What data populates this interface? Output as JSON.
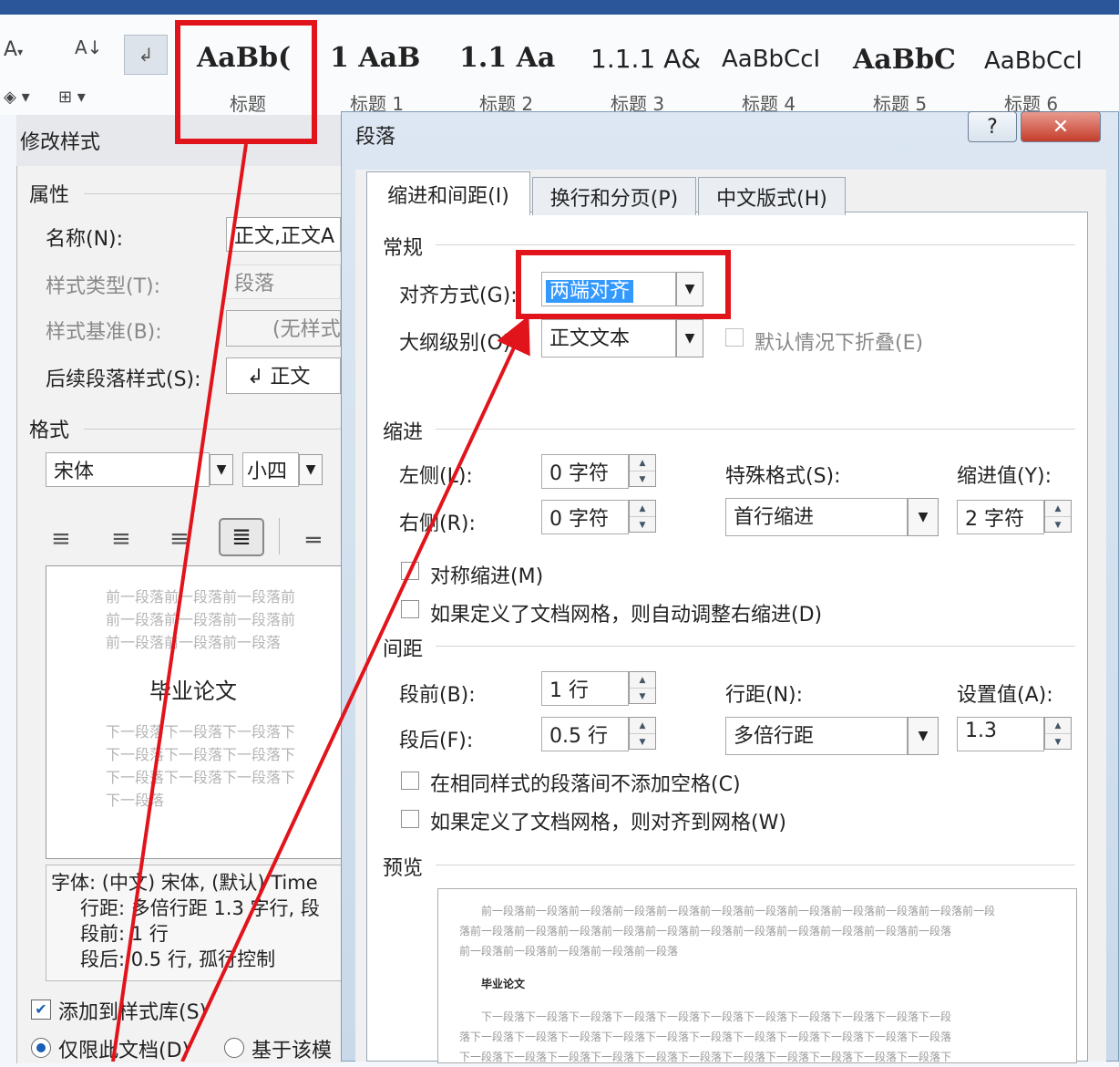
{
  "ribbon": {
    "styles": [
      {
        "sample": "AaBb(",
        "label": "标题"
      },
      {
        "sample": "1  AaB",
        "label": "标题 1"
      },
      {
        "sample": "1.1  Aa",
        "label": "标题 2"
      },
      {
        "sample": "1.1.1  A&",
        "label": "标题 3"
      },
      {
        "sample": "AaBbCcI",
        "label": "标题 4"
      },
      {
        "sample": "AaBbC",
        "label": "标题 5"
      },
      {
        "sample": "AaBbCcl",
        "label": "标题 6"
      }
    ]
  },
  "modify": {
    "title": "修改样式",
    "properties_header": "属性",
    "name_label": "名称(N):",
    "name_value": "正文,正文A",
    "type_label": "样式类型(T):",
    "type_value": "段落",
    "base_label": "样式基准(B):",
    "base_value": "(无样式",
    "next_label": "后续段落样式(S):",
    "next_value": "↲ 正文",
    "format_header": "格式",
    "font_value": "宋体",
    "size_value": "小四",
    "preview": {
      "prev_lines": [
        "前一段落前一段落前一段落前",
        "前一段落前一段落前一段落前",
        "前一段落前一段落前一段落"
      ],
      "sample": "毕业论文",
      "next_lines": [
        "下一段落下一段落下一段落下",
        "下一段落下一段落下一段落下",
        "下一段落下一段落下一段落下",
        "下一段落"
      ]
    },
    "desc_lines": [
      "字体: (中文) 宋体, (默认) Time",
      "行距: 多倍行距 1.3 字行, 段",
      "段前: 1 行",
      "段后: 0.5 行, 孤行控制"
    ],
    "add_to_gallery": "添加到样式库(S)",
    "only_doc": "仅限此文档(D)",
    "based_on_template": "基于该模"
  },
  "para": {
    "title": "段落",
    "help": "?",
    "close": "✕",
    "tabs": [
      "缩进和间距(I)",
      "换行和分页(P)",
      "中文版式(H)"
    ],
    "general": "常规",
    "align_label": "对齐方式(G):",
    "align_value": "两端对齐",
    "outline_label": "大纲级别(O):",
    "outline_value": "正文文本",
    "collapse_label": "默认情况下折叠(E)",
    "indent": "缩进",
    "left_label": "左侧(L):",
    "left_value": "0 字符",
    "right_label": "右侧(R):",
    "right_value": "0 字符",
    "special_label": "特殊格式(S):",
    "special_value": "首行缩进",
    "indent_by_label": "缩进值(Y):",
    "indent_by_value": "2 字符",
    "mirror_label": "对称缩进(M)",
    "auto_right_label": "如果定义了文档网格，则自动调整右缩进(D)",
    "spacing": "间距",
    "before_label": "段前(B):",
    "before_value": "1 行",
    "after_label": "段后(F):",
    "after_value": "0.5 行",
    "line_label": "行距(N):",
    "line_value": "多倍行距",
    "at_label": "设置值(A):",
    "at_value": "1.3",
    "no_space_label": "在相同样式的段落间不添加空格(C)",
    "snap_grid_label": "如果定义了文档网格，则对齐到网格(W)",
    "preview": "预览",
    "preview_prev": [
      "前一段落前一段落前一段落前一段落前一段落前一段落前一段落前一段落前一段落前一段落前一段落前一段",
      "落前一段落前一段落前一段落前一段落前一段落前一段落前一段落前一段落前一段落前一段落前一段落",
      "前一段落前一段落前一段落前一段落前一段落"
    ],
    "preview_sample": "毕业论文",
    "preview_next": [
      "下一段落下一段落下一段落下一段落下一段落下一段落下一段落下一段落下一段落下一段落下一段",
      "落下一段落下一段落下一段落下一段落下一段落下一段落下一段落下一段落下一段落下一段落下一段落",
      "下一段落下一段落下一段落下一段落下一段落下一段落下一段落下一段落下一段落下一段落下一段落下"
    ]
  },
  "colors": {
    "accent_red": "#e1141c",
    "selection_blue": "#3399ff",
    "title_bar": "#2b579a"
  }
}
